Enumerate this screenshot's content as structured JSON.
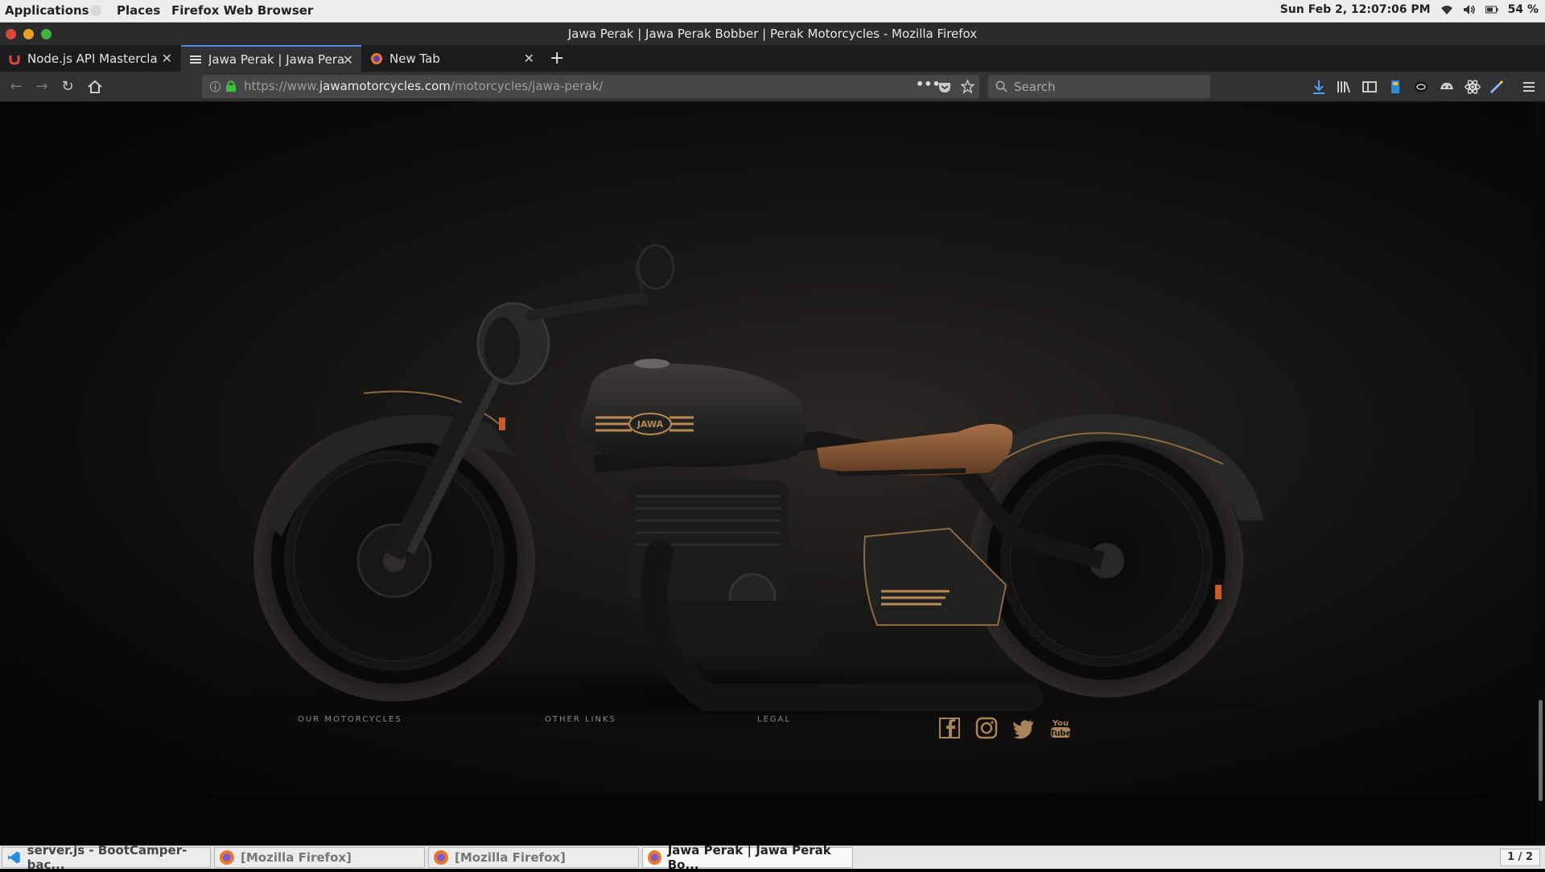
{
  "topbar": {
    "applications": "Applications",
    "places": "Places",
    "app_name": "Firefox Web Browser",
    "clock": "Sun Feb  2, 12:07:06 PM",
    "battery": "54 %"
  },
  "window": {
    "title": "Jawa Perak | Jawa Perak Bobber | Perak Motorcycles - Mozilla Firefox"
  },
  "tabs": [
    {
      "label": "Node.js API Mastercla",
      "active": false
    },
    {
      "label": "Jawa Perak | Jawa Pera",
      "active": true
    },
    {
      "label": "New Tab",
      "active": false
    }
  ],
  "navbar": {
    "url_prefix": "https://www.",
    "url_domain": "jawamotorcycles.com",
    "url_path": "/motorcycles/jawa-perak/",
    "search_placeholder": "Search"
  },
  "footer": {
    "col1": "OUR MOTORCYCLES",
    "col2": "OTHER LINKS",
    "col3": "LEGAL",
    "social": [
      "facebook-icon",
      "instagram-icon",
      "twitter-icon",
      "youtube-icon"
    ]
  },
  "bike": {
    "tank_badge": "JAWA"
  },
  "taskbar": {
    "items": [
      {
        "label": "server.js - BootCamper-bac...",
        "active": false
      },
      {
        "label": "[Mozilla Firefox]",
        "active": false
      },
      {
        "label": "[Mozilla Firefox]",
        "active": false
      },
      {
        "label": "Jawa Perak | Jawa Perak Bo...",
        "active": true
      }
    ],
    "workspace": "1 / 2"
  },
  "colors": {
    "tab_accent": "#5a86e8",
    "close_btn": "#e0443e",
    "min_btn": "#e8a226",
    "max_btn": "#3eb43e",
    "saddle": "#8a5a34",
    "bronze": "#b58a55"
  }
}
